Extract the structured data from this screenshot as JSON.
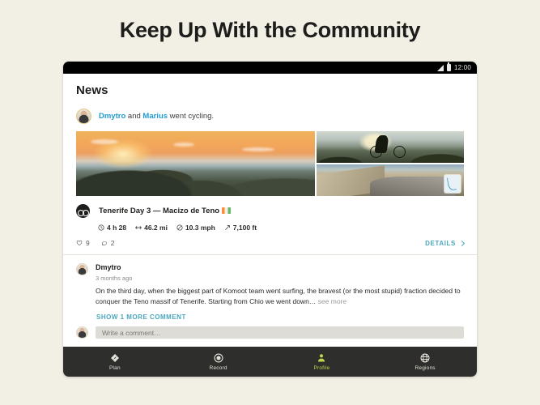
{
  "headline": "Keep Up With the Community",
  "statusbar": {
    "time": "12:00",
    "signal_icon": "signal-triangle-icon",
    "battery_icon": "battery-icon"
  },
  "screen": {
    "page_title": "News",
    "activity": {
      "user_one": "Dmytro",
      "connector": " and ",
      "user_two": "Marius",
      "suffix": " went cycling.",
      "avatar_icon": "user-avatar"
    },
    "photos": [
      {
        "name": "sunset-mountain-ridge-photo"
      },
      {
        "name": "cyclist-silhouette-photo"
      },
      {
        "name": "mountain-road-photo"
      }
    ],
    "map_badge_icon": "route-map-thumbnail",
    "tour": {
      "sport_icon": "bicycle-badge-icon",
      "title": "Tenerife Day 3 — Macizo de Teno",
      "flag_icon": "flag-icon",
      "stats": [
        {
          "icon": "clock-icon",
          "value": "4 h 28"
        },
        {
          "icon": "distance-icon",
          "value": "46.2 mi"
        },
        {
          "icon": "speed-icon",
          "value": "10.3 mph"
        },
        {
          "icon": "elevation-icon",
          "value": "7,100 ft"
        }
      ]
    },
    "engagement": {
      "like_icon": "heart-icon",
      "like_count": "9",
      "comment_icon": "comment-bubble-icon",
      "comment_count": "2",
      "details_label": "DETAILS",
      "details_chevron_icon": "chevron-right-icon"
    },
    "comment": {
      "avatar_icon": "commenter-avatar",
      "author": "Dmytro",
      "time": "3 months ago",
      "text": "On the third day, when the biggest part of Komoot team went surfing, the bravest (or the most stupid) fraction decided to conquer the Teno massif of Tenerife. Starting from Chio we went down…",
      "see_more": " see more",
      "show_more_label": "SHOW 1 MORE COMMENT"
    },
    "compose": {
      "avatar_icon": "current-user-avatar",
      "placeholder": "Write a comment…"
    }
  },
  "navbar": {
    "items": [
      {
        "label": "Plan",
        "icon": "compass-diamond-icon",
        "active": false
      },
      {
        "label": "Record",
        "icon": "record-circle-icon",
        "active": false
      },
      {
        "label": "Profile",
        "icon": "person-icon",
        "active": true
      },
      {
        "label": "Regions",
        "icon": "globe-icon",
        "active": false
      }
    ]
  },
  "colors": {
    "page_background": "#f2f0e4",
    "accent_link": "#1f9bd4",
    "accent_teal": "#4aa6bd",
    "nav_active": "#c3d54b",
    "nav_background": "#2e2e2c"
  }
}
